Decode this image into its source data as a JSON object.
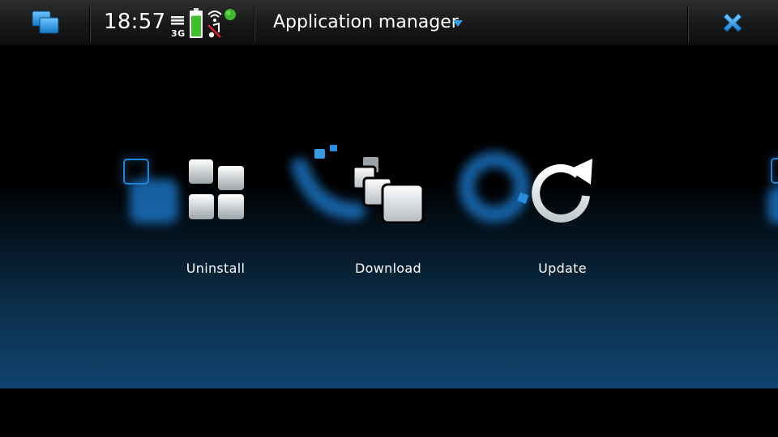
{
  "status_bar": {
    "time": "18:57",
    "network_label": "3G",
    "battery_level": 0.85,
    "icons": [
      "signal-icon",
      "battery-icon",
      "wifi-icon",
      "music-muted-icon",
      "presence-online-icon"
    ]
  },
  "title_bar": {
    "title": "Application manager",
    "menu_indicator": "dropdown-arrow-icon",
    "close_icon": "close-icon",
    "task_switcher_icon": "task-switcher-icon"
  },
  "main": {
    "items": [
      {
        "label": "Uninstall",
        "icon": "uninstall-icon"
      },
      {
        "label": "Download",
        "icon": "download-icon"
      },
      {
        "label": "Update",
        "icon": "update-icon"
      }
    ]
  },
  "colors": {
    "accent": "#29a2f0",
    "presence_online": "#3cb92a",
    "battery": "#3fbf2b",
    "glow_blue": "#1d7fd6"
  }
}
